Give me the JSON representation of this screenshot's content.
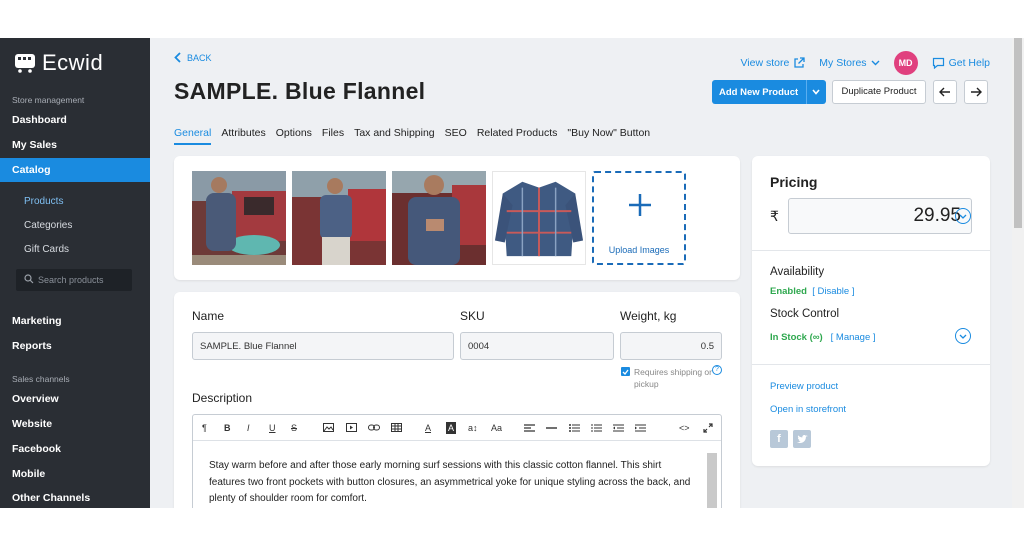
{
  "brand": {
    "name": "Ecwid"
  },
  "sidebar": {
    "section_store": "Store management",
    "dashboard": "Dashboard",
    "my_sales": "My Sales",
    "catalog": "Catalog",
    "sub": [
      "Products",
      "Categories",
      "Gift Cards"
    ],
    "search_placeholder": "Search products",
    "marketing": "Marketing",
    "reports": "Reports",
    "section_channels": "Sales channels",
    "channels": [
      "Overview",
      "Website",
      "Facebook",
      "Mobile",
      "Other Channels"
    ]
  },
  "header": {
    "back": "BACK",
    "title": "SAMPLE. Blue Flannel",
    "view_store": "View store",
    "my_stores": "My Stores",
    "avatar": "MD",
    "get_help": "Get Help",
    "add_new_product": "Add New Product",
    "duplicate_product": "Duplicate Product"
  },
  "tabs": [
    "General",
    "Attributes",
    "Options",
    "Files",
    "Tax and Shipping",
    "SEO",
    "Related Products",
    "\"Buy Now\" Button"
  ],
  "images": {
    "upload_label": "Upload Images"
  },
  "form": {
    "name_label": "Name",
    "name_value": "SAMPLE. Blue Flannel",
    "sku_label": "SKU",
    "sku_value": "0004",
    "weight_label": "Weight, kg",
    "weight_value": "0.5",
    "requires_shipping": "Requires shipping or pickup",
    "description_label": "Description",
    "description": "Stay warm before and after those early morning surf sessions with this classic cotton flannel. This shirt features two front pockets with button closures, an asymmetrical yoke for unique styling across the back, and plenty of shoulder room for comfort."
  },
  "pricing": {
    "title": "Pricing",
    "currency": "₹",
    "price": "29.95",
    "availability_label": "Availability",
    "availability_status": "Enabled",
    "disable": "[ Disable ]",
    "stock_label": "Stock Control",
    "stock_status": "In Stock (∞)",
    "manage": "[ Manage ]",
    "preview": "Preview product",
    "open_storefront": "Open in storefront"
  },
  "colors": {
    "accent": "#1a8be0",
    "sidebar": "#2a2e34",
    "success": "#2fa84f",
    "avatar": "#e0407e"
  }
}
